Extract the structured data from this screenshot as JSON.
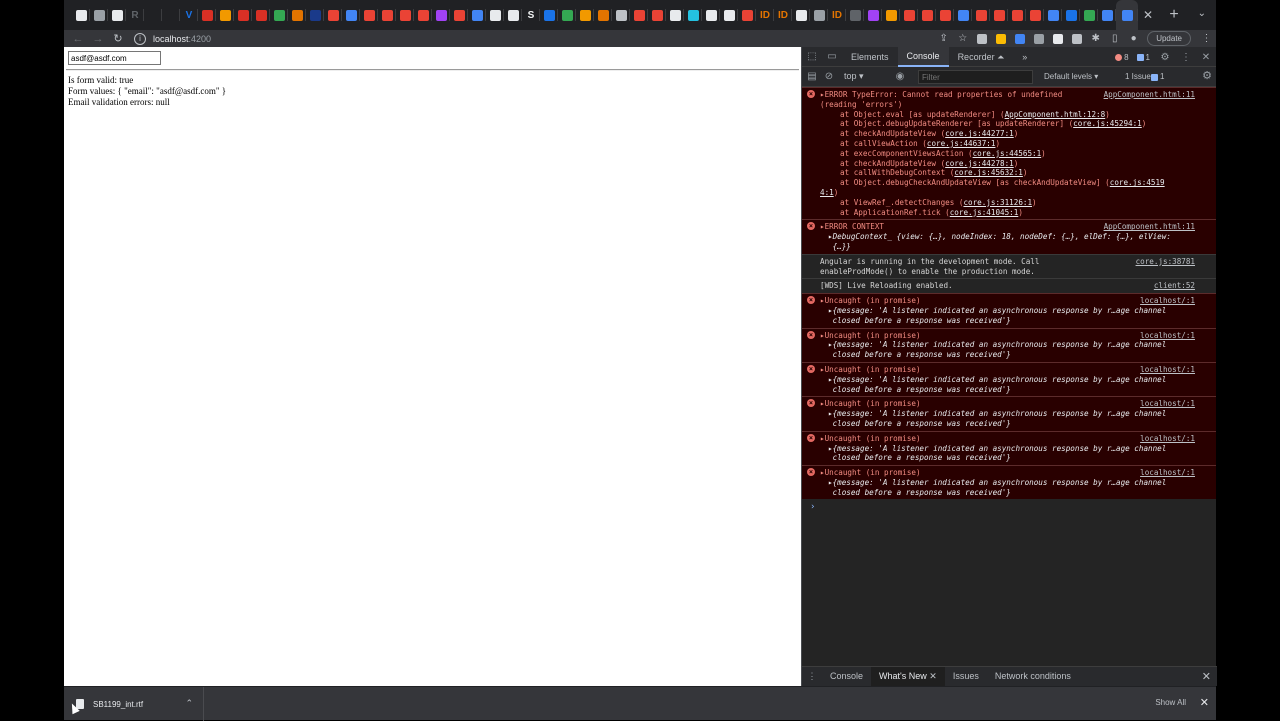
{
  "browser": {
    "tabs": [
      {
        "color": "#e8eaed",
        "glyph": "",
        "active": false
      },
      {
        "color": "#9aa0a6",
        "glyph": "",
        "active": false
      },
      {
        "color": "#e8eaed",
        "glyph": "",
        "active": false
      },
      {
        "color": "#5f6368",
        "glyph": "R",
        "active": false
      },
      {
        "color": "#202124",
        "glyph": "",
        "active": false
      },
      {
        "color": "#202124",
        "glyph": "",
        "active": false
      },
      {
        "color": "#1a73e8",
        "glyph": "V",
        "active": false
      },
      {
        "color": "#d93025",
        "glyph": "",
        "active": false
      },
      {
        "color": "#f29900",
        "glyph": "",
        "active": false
      },
      {
        "color": "#d93025",
        "glyph": "",
        "active": false
      },
      {
        "color": "#d93025",
        "glyph": "",
        "active": false
      },
      {
        "color": "#34a853",
        "glyph": "",
        "active": false
      },
      {
        "color": "#e37400",
        "glyph": "",
        "active": false
      },
      {
        "color": "#1a3a8a",
        "glyph": "",
        "active": false
      },
      {
        "color": "#ea4335",
        "glyph": "",
        "active": false
      },
      {
        "color": "#4285f4",
        "glyph": "",
        "active": false
      },
      {
        "color": "#ea4335",
        "glyph": "",
        "active": false
      },
      {
        "color": "#ea4335",
        "glyph": "",
        "active": false
      },
      {
        "color": "#ea4335",
        "glyph": "",
        "active": false
      },
      {
        "color": "#ea4335",
        "glyph": "",
        "active": false
      },
      {
        "color": "#a142f4",
        "glyph": "",
        "active": false
      },
      {
        "color": "#ea4335",
        "glyph": "",
        "active": false
      },
      {
        "color": "#4285f4",
        "glyph": "",
        "active": false
      },
      {
        "color": "#e8eaed",
        "glyph": "",
        "active": false
      },
      {
        "color": "#e8eaed",
        "glyph": "",
        "active": false
      },
      {
        "color": "#f1f3f4",
        "glyph": "S",
        "active": false
      },
      {
        "color": "#1a73e8",
        "glyph": "",
        "active": false
      },
      {
        "color": "#34a853",
        "glyph": "",
        "active": false
      },
      {
        "color": "#f29900",
        "glyph": "",
        "active": false
      },
      {
        "color": "#e37400",
        "glyph": "",
        "active": false
      },
      {
        "color": "#bdc1c6",
        "glyph": "",
        "active": false
      },
      {
        "color": "#ea4335",
        "glyph": "",
        "active": false
      },
      {
        "color": "#ea4335",
        "glyph": "",
        "active": false
      },
      {
        "color": "#e8eaed",
        "glyph": "",
        "active": false
      },
      {
        "color": "#24c1e0",
        "glyph": "",
        "active": false
      },
      {
        "color": "#e8eaed",
        "glyph": "",
        "active": false
      },
      {
        "color": "#e8eaed",
        "glyph": "",
        "active": false
      },
      {
        "color": "#ea4335",
        "glyph": "",
        "active": false
      },
      {
        "color": "#e37400",
        "glyph": "ID",
        "active": false
      },
      {
        "color": "#e37400",
        "glyph": "ID",
        "active": false
      },
      {
        "color": "#e8eaed",
        "glyph": "",
        "active": false
      },
      {
        "color": "#9aa0a6",
        "glyph": "",
        "active": false
      },
      {
        "color": "#e37400",
        "glyph": "ID",
        "active": false
      },
      {
        "color": "#5f6368",
        "glyph": "",
        "active": false
      },
      {
        "color": "#a142f4",
        "glyph": "",
        "active": false
      },
      {
        "color": "#f29900",
        "glyph": "",
        "active": false
      },
      {
        "color": "#ea4335",
        "glyph": "",
        "active": false
      },
      {
        "color": "#ea4335",
        "glyph": "",
        "active": false
      },
      {
        "color": "#ea4335",
        "glyph": "",
        "active": false
      },
      {
        "color": "#4285f4",
        "glyph": "",
        "active": false
      },
      {
        "color": "#ea4335",
        "glyph": "",
        "active": false
      },
      {
        "color": "#ea4335",
        "glyph": "",
        "active": false
      },
      {
        "color": "#ea4335",
        "glyph": "",
        "active": false
      },
      {
        "color": "#ea4335",
        "glyph": "",
        "active": false
      },
      {
        "color": "#4285f4",
        "glyph": "",
        "active": false
      },
      {
        "color": "#1a73e8",
        "glyph": "",
        "active": false
      },
      {
        "color": "#34a853",
        "glyph": "",
        "active": false
      },
      {
        "color": "#4285f4",
        "glyph": "",
        "active": false
      },
      {
        "color": "#4285f4",
        "glyph": "",
        "active": true
      }
    ],
    "tab_close_glyph": "✕",
    "new_tab_glyph": "+",
    "tab_search_glyph": "⌄",
    "back_glyph": "←",
    "forward_glyph": "→",
    "reload_glyph": "↻",
    "url_host": "localhost",
    "url_port": ":4200",
    "update_label": "Update",
    "ext_colors": [
      "#bdc1c6",
      "#fbbc04",
      "#4285f4",
      "#9aa0a6",
      "#e8eaed",
      "#bdc1c6"
    ]
  },
  "page": {
    "email_value": "asdf@asdf.com",
    "line_valid": "Is form valid: true",
    "line_values": "Form values: { \"email\": \"asdf@asdf.com\" }",
    "line_errors": "Email validation errors: null"
  },
  "devtools": {
    "tabs": [
      "Elements",
      "Console",
      "Recorder ⏶"
    ],
    "active_tab": "Console",
    "more_glyph": "»",
    "error_count": "8",
    "issue_count": "1",
    "context": "top ▾",
    "filter_placeholder": "Filter",
    "levels": "Default levels ▾",
    "issues_label": "1 Issue:",
    "issues_badge": "1",
    "messages": [
      {
        "kind": "error",
        "source": "AppComponent.html:11",
        "lines": [
          "▸ERROR TypeError: Cannot read properties of undefined",
          "(reading 'errors')"
        ],
        "frames": [
          {
            "text": "at Object.eval [as updateRenderer] (",
            "link": "AppComponent.html:12:8",
            "end": ")"
          },
          {
            "text": "at Object.debugUpdateRenderer [as updateRenderer] (",
            "link": "core.js:45294:1",
            "end": ")"
          },
          {
            "text": "at checkAndUpdateView (",
            "link": "core.js:44277:1",
            "end": ")"
          },
          {
            "text": "at callViewAction (",
            "link": "core.js:44637:1",
            "end": ")"
          },
          {
            "text": "at execComponentViewsAction (",
            "link": "core.js:44565:1",
            "end": ")"
          },
          {
            "text": "at checkAndUpdateView (",
            "link": "core.js:44278:1",
            "end": ")"
          },
          {
            "text": "at callWithDebugContext (",
            "link": "core.js:45632:1",
            "end": ")"
          },
          {
            "text": "at Object.debugCheckAndUpdateView [as checkAndUpdateView] (",
            "link": "core.js:4519",
            "end": ""
          },
          {
            "text": "",
            "link": "4:1",
            "end": ")",
            "outdent": true
          },
          {
            "text": "at ViewRef_.detectChanges (",
            "link": "core.js:31126:1",
            "end": ")"
          },
          {
            "text": "at ApplicationRef.tick (",
            "link": "core.js:41045:1",
            "end": ")"
          }
        ]
      },
      {
        "kind": "error",
        "source": "AppComponent.html:11",
        "lines": [
          "▸ERROR CONTEXT"
        ],
        "obj": [
          "▸DebugContext_ {view: {…}, nodeIndex: 18, nodeDef: {…}, elDef: {…}, elView:",
          " {…}}"
        ]
      },
      {
        "kind": "info",
        "source": "core.js:38781",
        "lines": [
          "Angular is running in the development mode. Call",
          "enableProdMode() to enable the production mode."
        ]
      },
      {
        "kind": "info",
        "source": "client:52",
        "lines": [
          "[WDS] Live Reloading enabled."
        ]
      },
      {
        "kind": "error",
        "source": "localhost/:1",
        "lines": [
          "▸Uncaught (in promise)"
        ],
        "obj": [
          "▸{message: 'A listener indicated an asynchronous response by r…age channel",
          " closed before a response was received'}"
        ]
      },
      {
        "kind": "error",
        "source": "localhost/:1",
        "lines": [
          "▸Uncaught (in promise)"
        ],
        "obj": [
          "▸{message: 'A listener indicated an asynchronous response by r…age channel",
          " closed before a response was received'}"
        ]
      },
      {
        "kind": "error",
        "source": "localhost/:1",
        "lines": [
          "▸Uncaught (in promise)"
        ],
        "obj": [
          "▸{message: 'A listener indicated an asynchronous response by r…age channel",
          " closed before a response was received'}"
        ]
      },
      {
        "kind": "error",
        "source": "localhost/:1",
        "lines": [
          "▸Uncaught (in promise)"
        ],
        "obj": [
          "▸{message: 'A listener indicated an asynchronous response by r…age channel",
          " closed before a response was received'}"
        ]
      },
      {
        "kind": "error",
        "source": "localhost/:1",
        "lines": [
          "▸Uncaught (in promise)"
        ],
        "obj": [
          "▸{message: 'A listener indicated an asynchronous response by r…age channel",
          " closed before a response was received'}"
        ]
      },
      {
        "kind": "error",
        "source": "localhost/:1",
        "lines": [
          "▸Uncaught (in promise)"
        ],
        "obj": [
          "▸{message: 'A listener indicated an asynchronous response by r…age channel",
          " closed before a response was received'}"
        ]
      }
    ],
    "prompt": "›",
    "drawer_tabs": [
      "Console",
      "What's New",
      "Issues",
      "Network conditions"
    ],
    "drawer_active": "What's New",
    "drawer_close": "✕"
  },
  "shelf": {
    "file_name": "SB1199_int.rtf",
    "chevron": "⌃",
    "show_all": "Show All",
    "close": "✕"
  }
}
